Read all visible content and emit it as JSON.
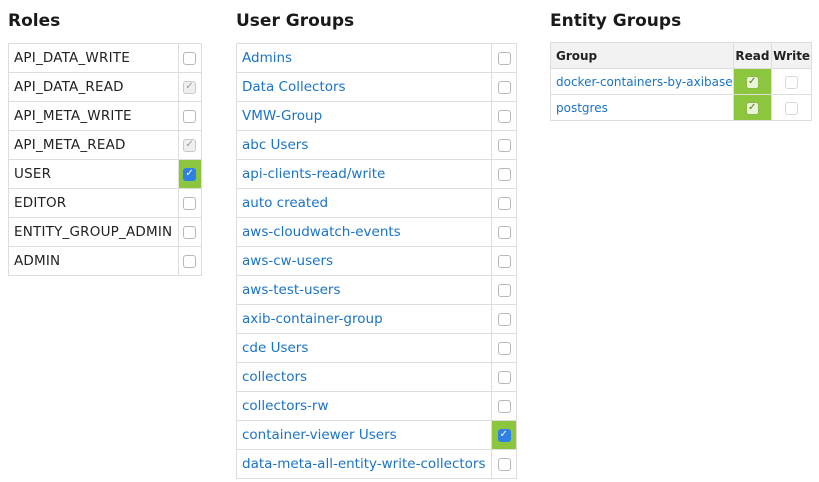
{
  "roles": {
    "title": "Roles",
    "items": [
      {
        "label": "API_DATA_WRITE",
        "checked": false,
        "state": "empty"
      },
      {
        "label": "API_DATA_READ",
        "checked": true,
        "state": "grey"
      },
      {
        "label": "API_META_WRITE",
        "checked": false,
        "state": "empty"
      },
      {
        "label": "API_META_READ",
        "checked": true,
        "state": "grey"
      },
      {
        "label": "USER",
        "checked": true,
        "state": "green"
      },
      {
        "label": "EDITOR",
        "checked": false,
        "state": "empty"
      },
      {
        "label": "ENTITY_GROUP_ADMIN",
        "checked": false,
        "state": "empty"
      },
      {
        "label": "ADMIN",
        "checked": false,
        "state": "empty"
      }
    ]
  },
  "user_groups": {
    "title": "User Groups",
    "items": [
      {
        "label": "Admins",
        "checked": false
      },
      {
        "label": "Data Collectors",
        "checked": false
      },
      {
        "label": "VMW-Group",
        "checked": false
      },
      {
        "label": "abc Users",
        "checked": false
      },
      {
        "label": "api-clients-read/write",
        "checked": false
      },
      {
        "label": "auto created",
        "checked": false
      },
      {
        "label": "aws-cloudwatch-events",
        "checked": false
      },
      {
        "label": "aws-cw-users",
        "checked": false
      },
      {
        "label": "aws-test-users",
        "checked": false
      },
      {
        "label": "axib-container-group",
        "checked": false
      },
      {
        "label": "cde Users",
        "checked": false
      },
      {
        "label": "collectors",
        "checked": false
      },
      {
        "label": "collectors-rw",
        "checked": false
      },
      {
        "label": "container-viewer Users",
        "checked": true
      },
      {
        "label": "data-meta-all-entity-write-collectors",
        "checked": false
      }
    ]
  },
  "entity_groups": {
    "title": "Entity Groups",
    "columns": {
      "group": "Group",
      "read": "Read",
      "write": "Write"
    },
    "rows": [
      {
        "group": "docker-containers-by-axibase",
        "read": true,
        "write": false
      },
      {
        "group": "postgres",
        "read": true,
        "write": false
      }
    ]
  },
  "colors": {
    "link": "#1a73c8",
    "checked_green": "#8cc63f",
    "checkbox_blue": "#2f80e6",
    "border": "#dddddd"
  }
}
